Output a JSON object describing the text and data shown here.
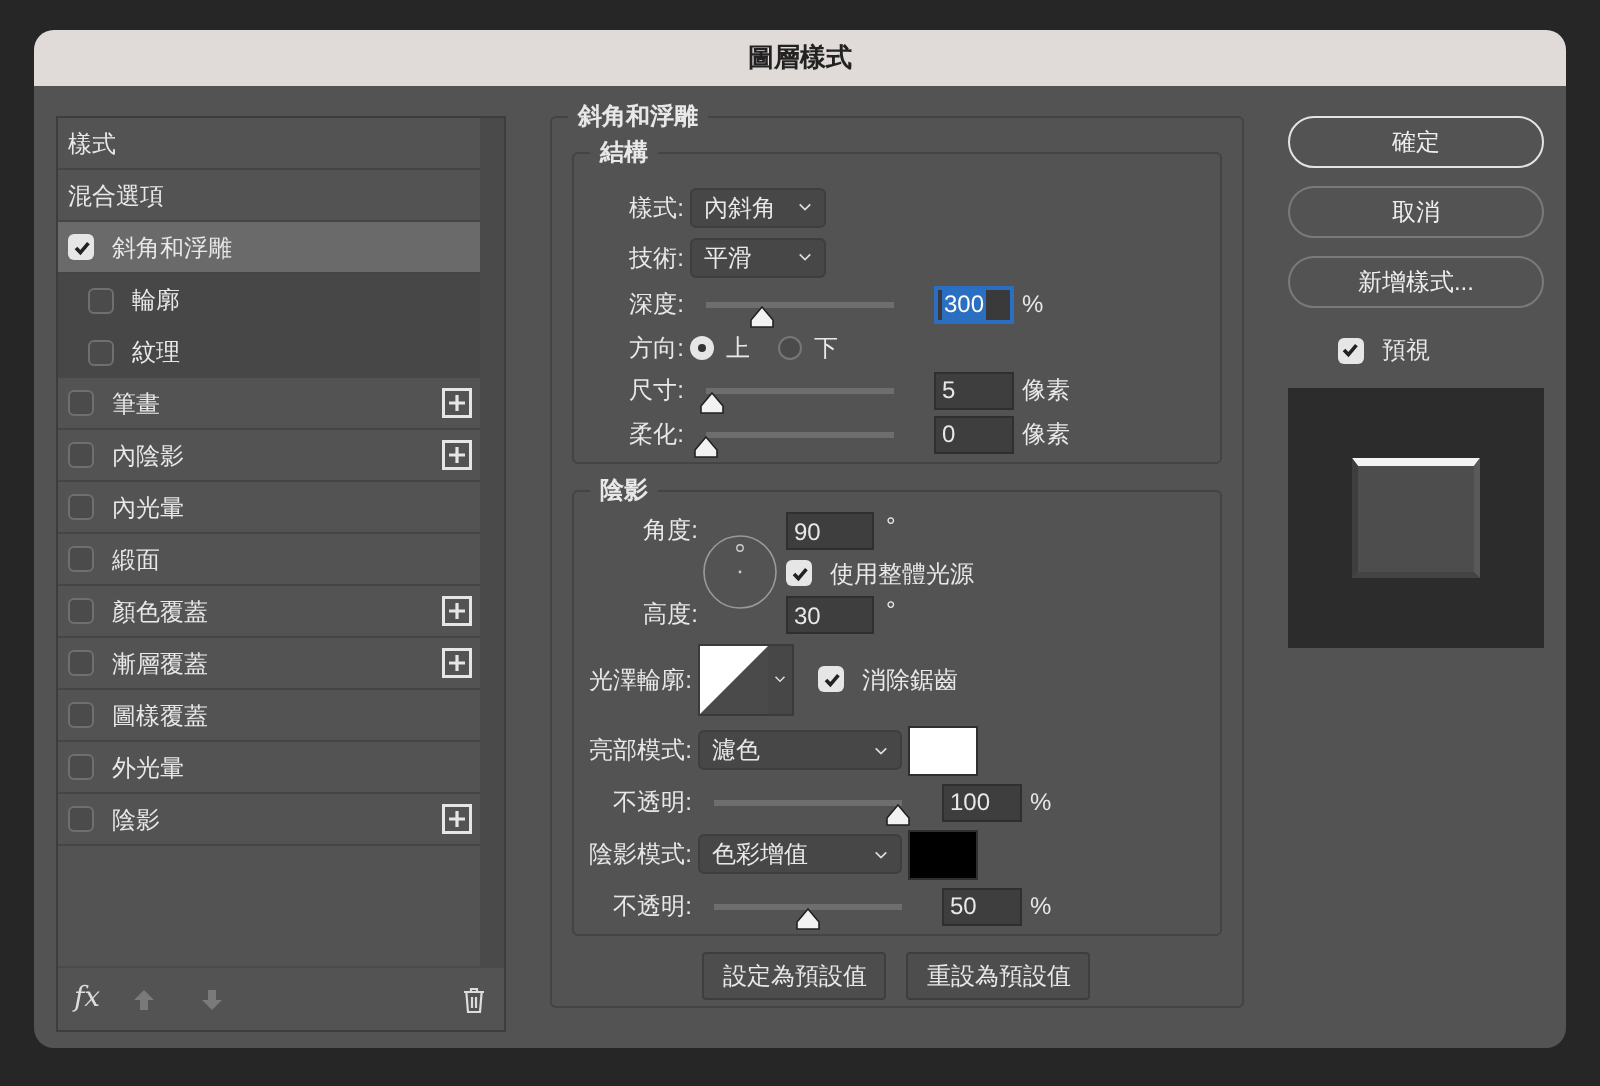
{
  "window": {
    "title": "圖層樣式"
  },
  "styles_list": [
    {
      "label": "樣式",
      "kind": "header",
      "selected": false
    },
    {
      "label": "混合選項",
      "kind": "header",
      "selected": false
    },
    {
      "label": "斜角和浮雕",
      "kind": "effect",
      "checked": true,
      "selected": true,
      "addable": false
    },
    {
      "label": "輪廓",
      "kind": "sub",
      "checked": false,
      "selected": false,
      "addable": false
    },
    {
      "label": "紋理",
      "kind": "sub",
      "checked": false,
      "selected": false,
      "addable": false
    },
    {
      "label": "筆畫",
      "kind": "effect",
      "checked": false,
      "selected": false,
      "addable": true
    },
    {
      "label": "內陰影",
      "kind": "effect",
      "checked": false,
      "selected": false,
      "addable": true
    },
    {
      "label": "內光暈",
      "kind": "effect",
      "checked": false,
      "selected": false,
      "addable": false
    },
    {
      "label": "緞面",
      "kind": "effect",
      "checked": false,
      "selected": false,
      "addable": false
    },
    {
      "label": "顏色覆蓋",
      "kind": "effect",
      "checked": false,
      "selected": false,
      "addable": true
    },
    {
      "label": "漸層覆蓋",
      "kind": "effect",
      "checked": false,
      "selected": false,
      "addable": true
    },
    {
      "label": "圖樣覆蓋",
      "kind": "effect",
      "checked": false,
      "selected": false,
      "addable": false
    },
    {
      "label": "外光暈",
      "kind": "effect",
      "checked": false,
      "selected": false,
      "addable": false
    },
    {
      "label": "陰影",
      "kind": "effect",
      "checked": false,
      "selected": false,
      "addable": true
    }
  ],
  "list_footer": {
    "fx": "fx"
  },
  "bevel": {
    "title": "斜角和浮雕",
    "structure": {
      "title": "結構",
      "style": {
        "label": "樣式:",
        "value": "內斜角"
      },
      "technique": {
        "label": "技術:",
        "value": "平滑"
      },
      "depth": {
        "label": "深度:",
        "level": 0.3,
        "value": "300",
        "selected": true,
        "unit": "%"
      },
      "direction": {
        "label": "方向:",
        "options": [
          {
            "label": "上",
            "selected": true
          },
          {
            "label": "下",
            "selected": false
          }
        ]
      },
      "size": {
        "label": "尺寸:",
        "level": 0.03,
        "value": "5",
        "selected": false,
        "unit": "像素"
      },
      "soften": {
        "label": "柔化:",
        "level": 0,
        "value": "0",
        "selected": false,
        "unit": "像素"
      }
    },
    "shading": {
      "title": "陰影",
      "angle": {
        "label": "角度:",
        "value": "90",
        "unit": "°"
      },
      "global_light": {
        "label": "使用整體光源",
        "checked": true
      },
      "altitude": {
        "label": "高度:",
        "value": "30",
        "unit": "°"
      },
      "gloss_contour": {
        "label": "光澤輪廓:"
      },
      "anti_alias": {
        "label": "消除鋸齒",
        "checked": true
      },
      "highlight_mode": {
        "label": "亮部模式:",
        "value": "濾色",
        "color": "#ffffff"
      },
      "highlight_opacity": {
        "label": "不透明:",
        "level": 0.98,
        "value": "100",
        "selected": false,
        "unit": "%"
      },
      "shadow_mode": {
        "label": "陰影模式:",
        "value": "色彩增值",
        "color": "#000000"
      },
      "shadow_opacity": {
        "label": "不透明:",
        "level": 0.5,
        "value": "50",
        "selected": false,
        "unit": "%"
      }
    },
    "buttons": [
      "設定為預設值",
      "重設為預設值"
    ]
  },
  "actions": [
    {
      "label": "確定",
      "default": true
    },
    {
      "label": "取消",
      "default": false
    },
    {
      "label": "新增樣式...",
      "default": false
    }
  ],
  "preview": {
    "label": "預視",
    "checked": true
  }
}
